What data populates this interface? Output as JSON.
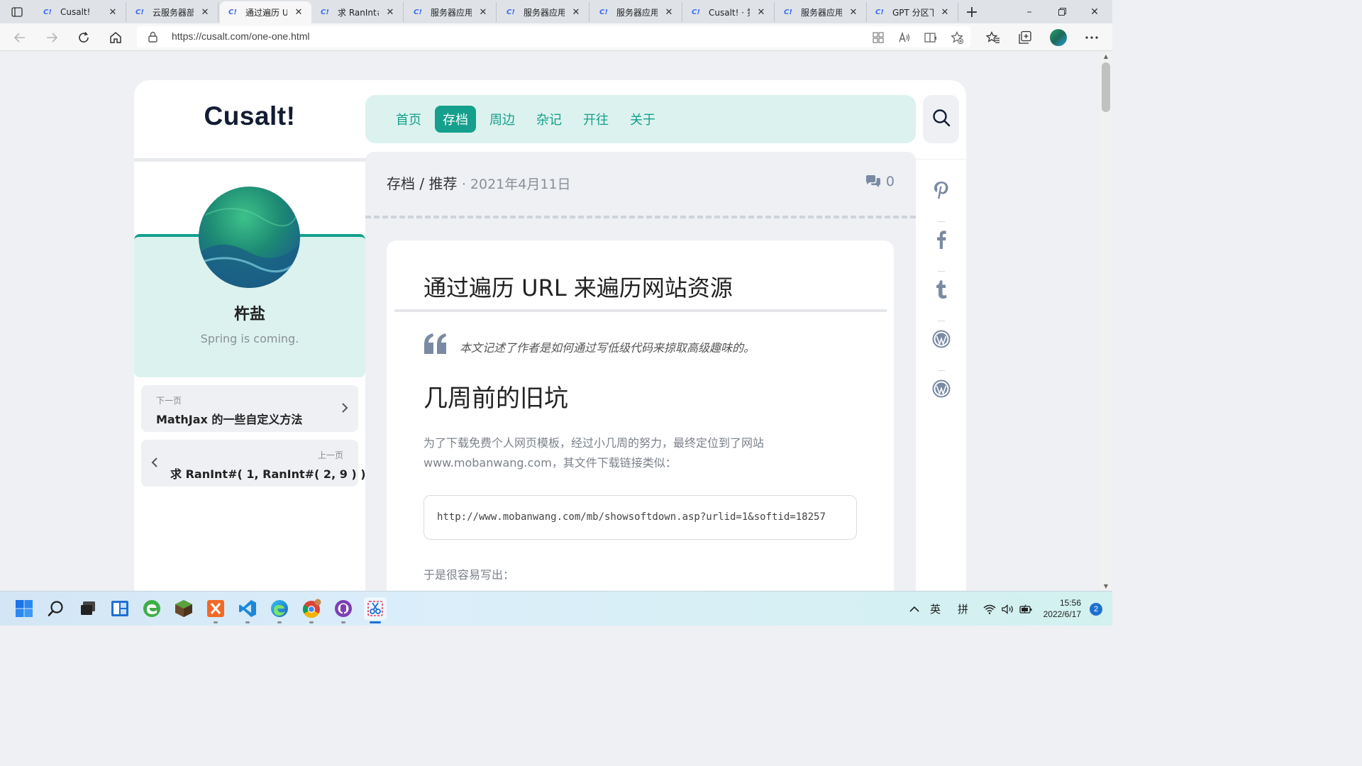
{
  "browser": {
    "tabs": [
      {
        "title": "Cusalt!",
        "active": false
      },
      {
        "title": "云服务器部",
        "active": false
      },
      {
        "title": "通过遍历 U",
        "active": true
      },
      {
        "title": "求 RanInt#(",
        "active": false
      },
      {
        "title": "服务器应用",
        "active": false
      },
      {
        "title": "服务器应用",
        "active": false
      },
      {
        "title": "服务器应用",
        "active": false
      },
      {
        "title": "Cusalt! · 第",
        "active": false
      },
      {
        "title": "服务器应用",
        "active": false
      },
      {
        "title": "GPT 分区下",
        "active": false
      }
    ],
    "favicon_text": "C!",
    "url": "https://cusalt.com/one-one.html"
  },
  "site": {
    "logo": "Cusalt!",
    "menu": [
      {
        "label": "首页",
        "active": false
      },
      {
        "label": "存档",
        "active": true
      },
      {
        "label": "周边",
        "active": false
      },
      {
        "label": "杂记",
        "active": false
      },
      {
        "label": "开往",
        "active": false
      },
      {
        "label": "关于",
        "active": false
      }
    ],
    "profile": {
      "name": "杵盐",
      "motto": "Spring is coming."
    },
    "next_page": {
      "hint": "下一页",
      "title": "MathJax 的一些自定义方法"
    },
    "prev_page": {
      "hint": "上一页",
      "title": "求 RanInt#( 1, RanInt#( 2, 9 ) )..."
    }
  },
  "post": {
    "breadcrumb": "存档 / 推荐",
    "date": "· 2021年4月11日",
    "comment_count": "0",
    "title": "通过遍历 URL 来遍历网站资源",
    "quote": "本文记述了作者是如何通过写低级代码来掠取高级趣味的。",
    "heading": "几周前的旧坑",
    "paragraph": "为了下载免费个人网页模板，经过小几周的努力，最终定位到了网站 www.mobanwang.com，其文件下载链接类似：",
    "code": "http://www.mobanwang.com/mb/showsoftdown.asp?urlid=1&softid=18257",
    "paragraph2": "于是很容易写出："
  },
  "share_icons": [
    "pinterest-icon",
    "facebook-icon",
    "tumblr-icon",
    "wordpress-icon",
    "wordpress-icon"
  ],
  "taskbar": {
    "lang": "英",
    "ime": "拼",
    "time": "15:56",
    "date": "2022/6/17",
    "notifications": "2"
  },
  "colors": {
    "accent": "#14a08c",
    "accent_bg": "#dcf2ee",
    "page_bg": "#eef0f4",
    "logo": "#131c33"
  }
}
